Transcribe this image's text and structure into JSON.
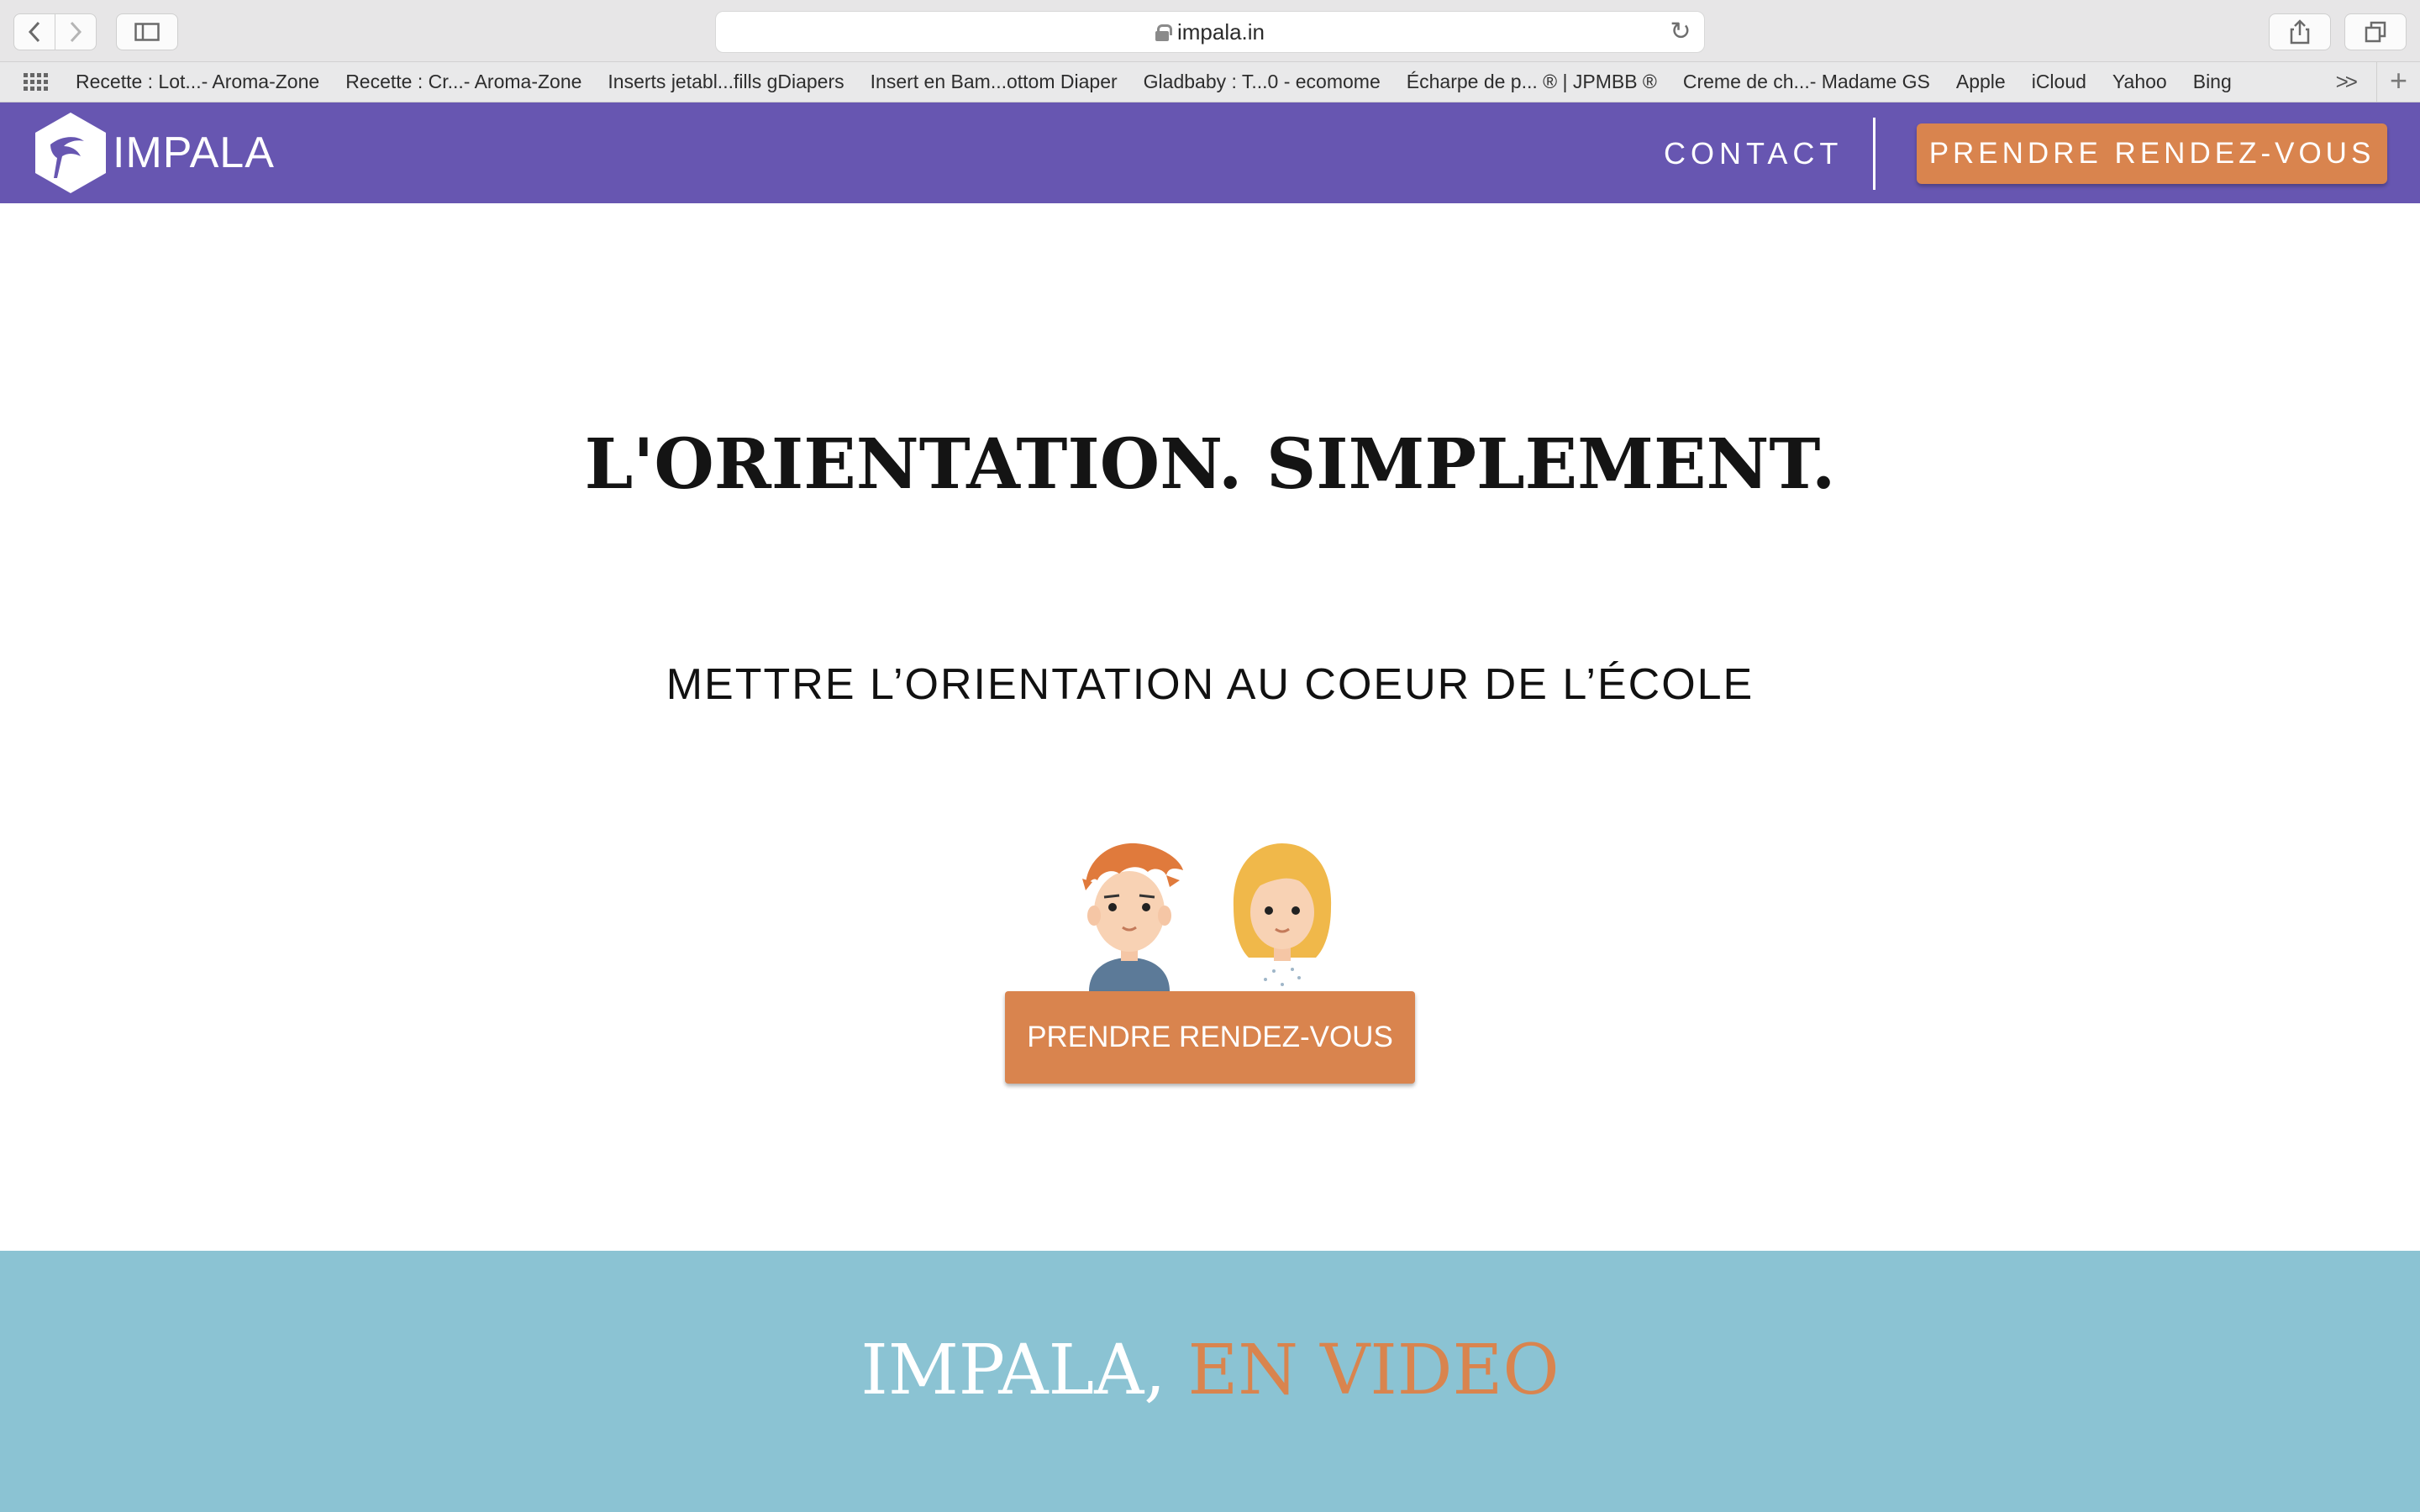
{
  "browser": {
    "url": "impala.in",
    "bookmarks": [
      "Recette : Lot...- Aroma-Zone",
      "Recette : Cr...- Aroma-Zone",
      "Inserts jetabl...fills gDiapers",
      "Insert en Bam...ottom Diaper",
      "Gladbaby : T...0 - ecomome",
      "Écharpe de p... ® | JPMBB ®",
      "Creme de ch...- Madame GS",
      "Apple",
      "iCloud",
      "Yahoo",
      "Bing"
    ],
    "more_label": ">>"
  },
  "header": {
    "logo_text": "IMPALA",
    "contact_label": "CONTACT",
    "cta_label": "PRENDRE RENDEZ-VOUS"
  },
  "hero": {
    "title": "L'ORIENTATION. SIMPLEMENT.",
    "subtitle": "METTRE L’ORIENTATION AU COEUR DE L’ÉCOLE",
    "cta_label": "PRENDRE RENDEZ-VOUS"
  },
  "video": {
    "title_part1": "IMPALA, ",
    "title_part2": "EN VIDEO"
  },
  "colors": {
    "header_bg": "#6756b1",
    "accent": "#d9844e",
    "video_bg": "#8bc3d3"
  }
}
